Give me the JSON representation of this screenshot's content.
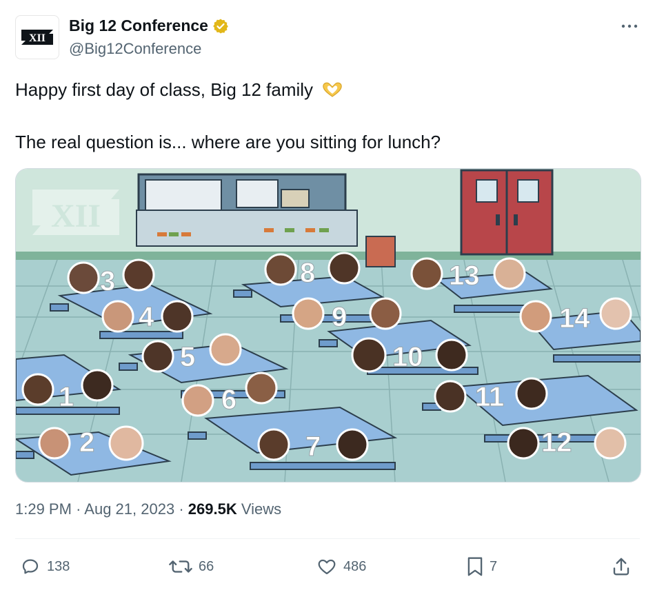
{
  "author": {
    "display_name": "Big 12 Conference",
    "handle": "@Big12Conference",
    "logo_text": "XII"
  },
  "tweet": {
    "line1": "Happy first day of class, Big 12 family",
    "line2": "The real question is... where are you sitting for lunch?"
  },
  "image": {
    "watermark": "XII",
    "table_numbers": [
      "1",
      "2",
      "3",
      "4",
      "5",
      "6",
      "7",
      "8",
      "9",
      "10",
      "11",
      "12",
      "13",
      "14"
    ],
    "colors": {
      "floor": "#a9cfcf",
      "wall": "#cfe6dc",
      "table": "#8fb8e3",
      "door": "#b8464a"
    }
  },
  "meta": {
    "time": "1:29 PM",
    "date": "Aug 21, 2023",
    "views_count": "269.5K",
    "views_label": "Views"
  },
  "actions": {
    "replies": "138",
    "reposts": "66",
    "likes": "486",
    "bookmarks": "7"
  },
  "colors": {
    "text_primary": "#0f1419",
    "text_secondary": "#536471",
    "verified_gold": "#e2b719"
  }
}
